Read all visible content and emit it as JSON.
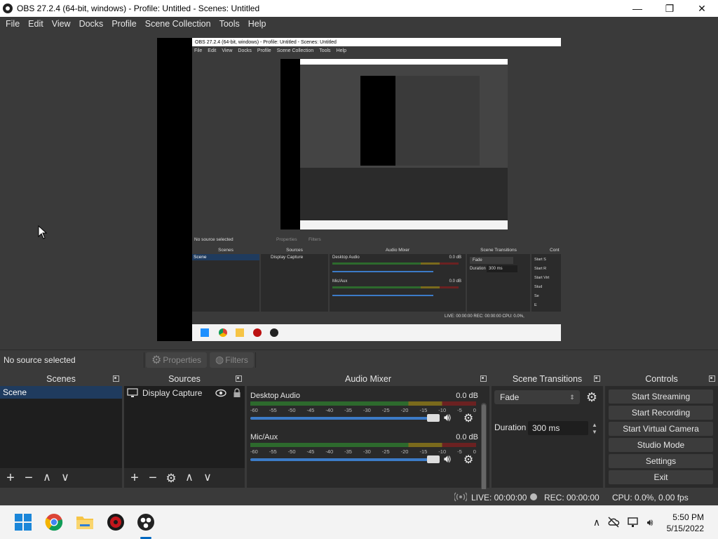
{
  "window": {
    "title": "OBS 27.2.4 (64-bit, windows) - Profile: Untitled - Scenes: Untitled",
    "minimize": "—",
    "maximize": "❐",
    "close": "✕"
  },
  "menu": [
    "File",
    "Edit",
    "View",
    "Docks",
    "Profile",
    "Scene Collection",
    "Tools",
    "Help"
  ],
  "nested": {
    "title": "OBS 27.2.4 (64-bit, windows) - Profile: Untitled - Scenes: Untitled",
    "menu": [
      "File",
      "Edit",
      "View",
      "Docks",
      "Profile",
      "Scene Collection",
      "Tools",
      "Help"
    ],
    "no_source": "No source selected",
    "properties": "Properties",
    "filters": "Filters",
    "scenes_title": "Scenes",
    "sources_title": "Sources",
    "mixer_title": "Audio Mixer",
    "transitions_title": "Scene Transitions",
    "controls_title": "Cont",
    "scene_item": "Scene",
    "source_item": "Display Capture",
    "desktop_audio": "Desktop Audio",
    "mic_aux": "Mic/Aux",
    "db": "0.0 dB",
    "fade": "Fade",
    "duration": "Duration",
    "duration_value": "300 ms",
    "ctrl_items": [
      "Start S",
      "Start R",
      "Start Virt",
      "Stud",
      "Se",
      "E"
    ],
    "status": "LIVE: 00:00:00   REC: 00:00:00   CPU: 0.0%,"
  },
  "sourcebar": {
    "no_source": "No source selected",
    "properties": "Properties",
    "filters": "Filters"
  },
  "scenes": {
    "title": "Scenes",
    "items": [
      "Scene"
    ]
  },
  "sources": {
    "title": "Sources",
    "items": [
      "Display Capture"
    ]
  },
  "mixer": {
    "title": "Audio Mixer",
    "channels": [
      {
        "name": "Desktop Audio",
        "db": "0.0 dB",
        "volume": 1.0
      },
      {
        "name": "Mic/Aux",
        "db": "0.0 dB",
        "volume": 1.0
      }
    ],
    "scale": [
      "-60",
      "-55",
      "-50",
      "-45",
      "-40",
      "-35",
      "-30",
      "-25",
      "-20",
      "-15",
      "-10",
      "-5",
      "0"
    ]
  },
  "transitions": {
    "title": "Scene Transitions",
    "selected": "Fade",
    "duration_label": "Duration",
    "duration_value": "300 ms"
  },
  "controls": {
    "title": "Controls",
    "buttons": [
      "Start Streaming",
      "Start Recording",
      "Start Virtual Camera",
      "Studio Mode",
      "Settings",
      "Exit"
    ]
  },
  "status": {
    "live": "LIVE: 00:00:00",
    "rec": "REC: 00:00:00",
    "cpu": "CPU: 0.0%, 0.00 fps"
  },
  "taskbar": {
    "time": "5:50 PM",
    "date": "5/15/2022",
    "apps": [
      "windows-start",
      "chrome",
      "file-explorer",
      "app-red",
      "obs"
    ]
  }
}
